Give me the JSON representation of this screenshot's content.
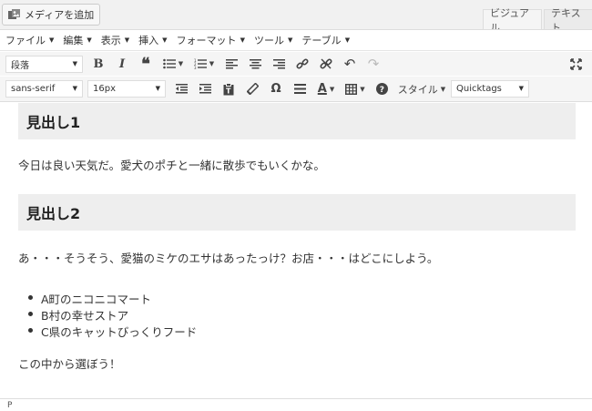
{
  "top": {
    "media_button": "メディアを追加",
    "tab_visual": "ビジュアル",
    "tab_text": "テキスト"
  },
  "menubar": {
    "items": [
      "ファイル",
      "編集",
      "表示",
      "挿入",
      "フォーマット",
      "ツール",
      "テーブル"
    ]
  },
  "toolbar1": {
    "format_select": "段落"
  },
  "toolbar2": {
    "font_family": "sans-serif",
    "font_size": "16px",
    "style_label": "スタイル",
    "quicktags": "Quicktags"
  },
  "content": {
    "heading1": "見出し1",
    "para1": "今日は良い天気だ。愛犬のポチと一緒に散歩でもいくかな。",
    "heading2": "見出し2",
    "para2": "あ・・・そうそう、愛猫のミケのエサはあったっけ？お店・・・はどこにしよう。",
    "list": [
      "A町のニコニコマート",
      "B村の幸せストア",
      "C県のキャットびっくりフード"
    ],
    "para3": "この中から選ぼう！"
  },
  "status": {
    "path": "P"
  },
  "icons": {
    "colors": {
      "text_color_underline": "#333333",
      "accent": "#0073aa"
    }
  }
}
